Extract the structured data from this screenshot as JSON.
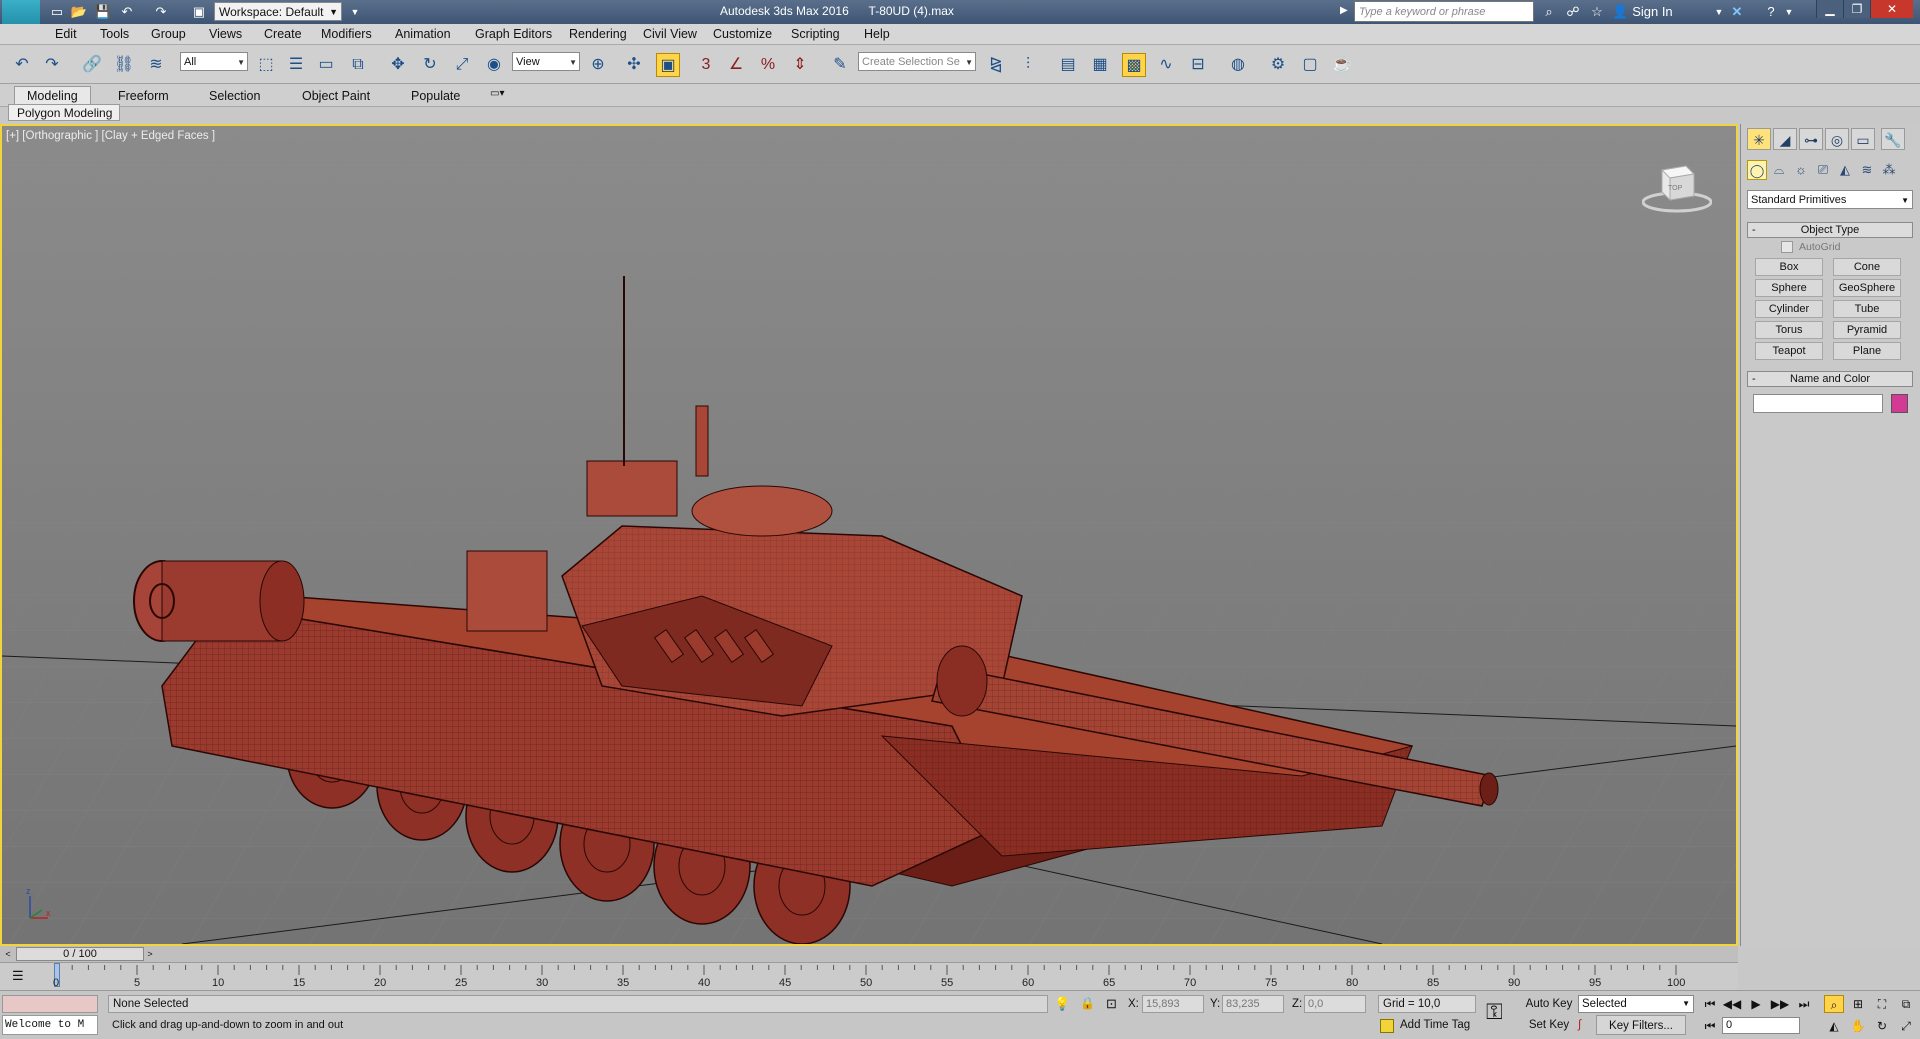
{
  "titlebar": {
    "app_logo": "MAX",
    "workspace": "Workspace: Default",
    "app_title": "Autodesk 3ds Max 2016",
    "file_name": "T-80UD (4).max",
    "search_placeholder": "Type a keyword or phrase",
    "sign_in": "Sign In"
  },
  "menu": [
    "Edit",
    "Tools",
    "Group",
    "Views",
    "Create",
    "Modifiers",
    "Animation",
    "Graph Editors",
    "Rendering",
    "Civil View",
    "Customize",
    "Scripting",
    "Help"
  ],
  "toolbar": {
    "selection_filter": "All",
    "ref_coord": "View",
    "snap_labels": [
      "3",
      "",
      "%",
      ""
    ],
    "named_selection_placeholder": "Create Selection Se"
  },
  "ribbon": {
    "tabs": [
      "Modeling",
      "Freeform",
      "Selection",
      "Object Paint",
      "Populate"
    ],
    "active_tab": "Modeling",
    "sub_panel": "Polygon Modeling"
  },
  "viewport": {
    "label": "[+] [Orthographic ] [Clay + Edged Faces ]",
    "object_color": "#9e3a2f",
    "viewcube_label": "TOP"
  },
  "command_panel": {
    "primitive_category": "Standard Primitives",
    "object_type_title": "Object Type",
    "autogrid_label": "AutoGrid",
    "buttons": [
      "Box",
      "Cone",
      "Sphere",
      "GeoSphere",
      "Cylinder",
      "Tube",
      "Torus",
      "Pyramid",
      "Teapot",
      "Plane"
    ],
    "name_color_title": "Name and Color",
    "object_name": "",
    "object_color": "#d33a96"
  },
  "timeline": {
    "frame_display": "0 / 100",
    "ticks": [
      "0",
      "5",
      "10",
      "15",
      "20",
      "25",
      "30",
      "35",
      "40",
      "45",
      "50",
      "55",
      "60",
      "65",
      "70",
      "75",
      "80",
      "85",
      "90",
      "95",
      "100"
    ]
  },
  "status": {
    "listener_text": "Welcome to M",
    "selection_status": "None Selected",
    "prompt": "Click and drag up-and-down to zoom in and out",
    "x_label": "X:",
    "x_value": "15,893",
    "y_label": "Y:",
    "y_value": "83,235",
    "z_label": "Z:",
    "z_value": "0,0",
    "grid": "Grid = 10,0",
    "add_time_tag": "Add Time Tag",
    "auto_key": "Auto Key",
    "set_key": "Set Key",
    "key_mode": "Selected",
    "key_filters": "Key Filters...",
    "current_frame": "0"
  }
}
